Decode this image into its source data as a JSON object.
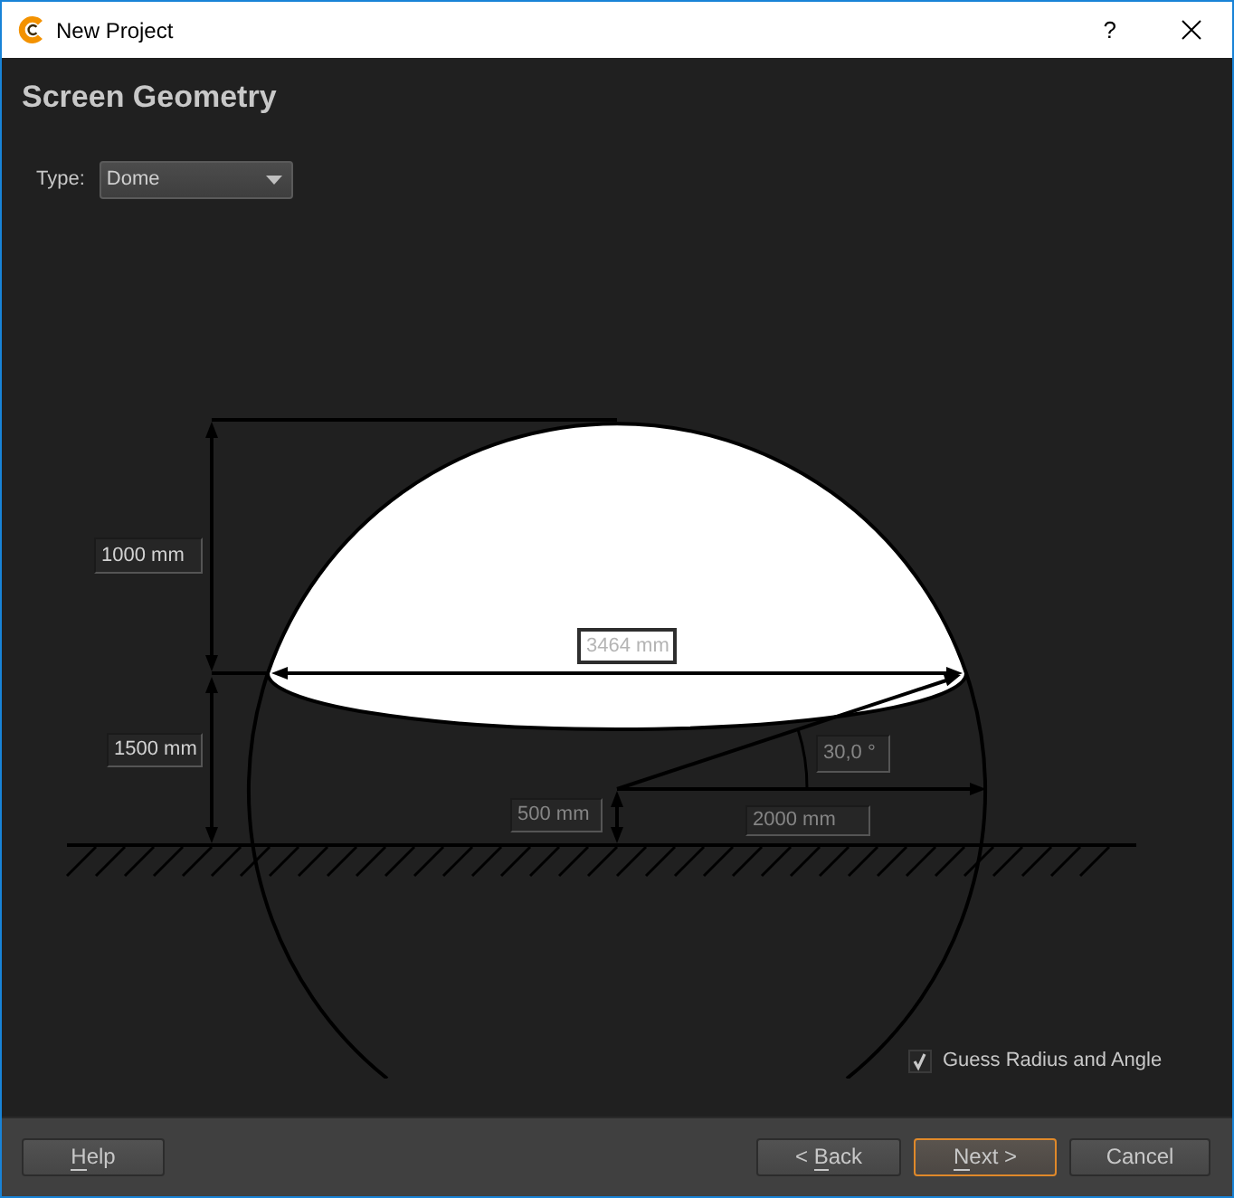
{
  "window": {
    "title": "New Project",
    "help_button": "?"
  },
  "page": {
    "heading": "Screen Geometry",
    "type_selector": {
      "label": "Type:",
      "value": "Dome"
    }
  },
  "diagram": {
    "dome_height": {
      "value": "1000 mm",
      "disabled": false
    },
    "base_height": {
      "value": "1500 mm",
      "disabled": false
    },
    "chord": {
      "value": "3464 mm",
      "disabled": true
    },
    "angle": {
      "value": "30,0 °",
      "disabled": true
    },
    "center_height": {
      "value": "500 mm",
      "disabled": true
    },
    "radius": {
      "value": "2000 mm",
      "disabled": true
    }
  },
  "guess_checkbox": {
    "label": "Guess Radius and Angle",
    "checked": true
  },
  "buttons": [
    {
      "parts": [
        {
          "text": "H",
          "underline": true
        },
        {
          "text": "elp",
          "underline": false
        }
      ],
      "default": false
    },
    {
      "parts": [
        {
          "text": "< ",
          "underline": false
        },
        {
          "text": "B",
          "underline": true
        },
        {
          "text": "ack",
          "underline": false
        }
      ],
      "default": false
    },
    {
      "parts": [
        {
          "text": "N",
          "underline": true
        },
        {
          "text": "ext >",
          "underline": false
        }
      ],
      "default": true
    },
    {
      "parts": [
        {
          "text": "Cancel",
          "underline": false
        }
      ],
      "default": false
    }
  ]
}
